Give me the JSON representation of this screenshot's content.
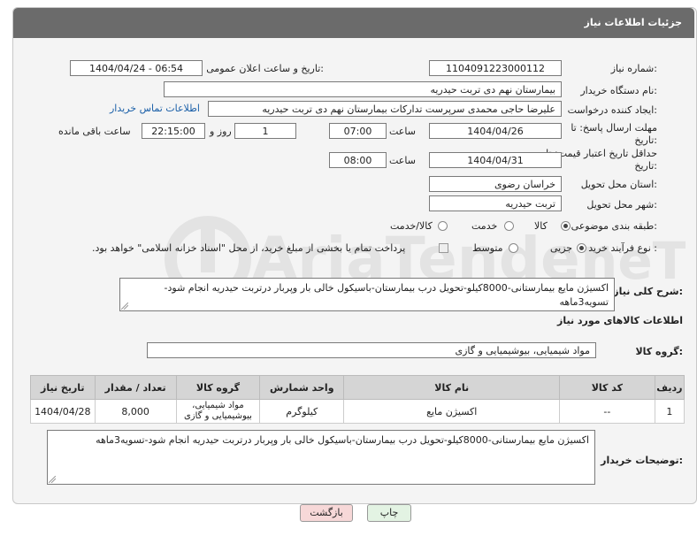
{
  "header": {
    "title": "جزئیات اطلاعات نیاز"
  },
  "fields": {
    "need_number_label": "شماره نیاز:",
    "need_number": "1104091223000112",
    "announce_label": "تاریخ و ساعت اعلان عمومی:",
    "announce_value": "1404/04/24 - 06:54",
    "buyer_org_label": "نام دستگاه خریدار:",
    "buyer_org": "بیمارستان نهم دی تربت حیدریه",
    "requester_label": "ایجاد کننده درخواست:",
    "requester": "علیرضا حاجی محمدی سرپرست تدارکات بیمارستان نهم دی تربت حیدریه",
    "buyer_contact_link": "اطلاعات تماس خریدار",
    "reply_deadline_label": "مهلت ارسال پاسخ: تا تاریخ:",
    "reply_date": "1404/04/26",
    "time_label": "ساعت",
    "reply_time": "07:00",
    "days_value": "1",
    "days_label": "روز و",
    "remaining_time": "22:15:00",
    "remaining_label": "ساعت باقی مانده",
    "price_validity_label": "حداقل تاریخ اعتبار قیمت: تا تاریخ:",
    "validity_date": "1404/04/31",
    "validity_time": "08:00",
    "province_label": "استان محل تحویل:",
    "province": "خراسان رضوی",
    "city_label": "شهر محل تحویل:",
    "city": "تربت حیدریه",
    "category_label": "طبقه بندی موضوعی:",
    "category_options": [
      "کالا",
      "خدمت",
      "کالا/خدمت"
    ],
    "process_label": "نوع فرآیند خرید :",
    "process_options": [
      "جزیی",
      "متوسط"
    ],
    "payment_note": "پرداخت تمام یا بخشی از مبلغ خرید، از محل \"اسناد خزانه اسلامی\" خواهد بود."
  },
  "description": {
    "label": "شرح کلی نیاز:",
    "text": "اکسیژن مایع بیمارستانی-8000کیلو-تحویل درب بیمارستان-باسیکول خالی بار وپربار درتربت حیدریه انجام شود-تسویه3ماهه"
  },
  "goods": {
    "section_title": "اطلاعات کالاهای مورد نیاز",
    "group_label": "گروه کالا:",
    "group_value": "مواد شیمیایی، بیوشیمیایی و  گازی",
    "columns": [
      "ردیف",
      "کد کالا",
      "نام کالا",
      "واحد شمارش",
      "گروه کالا",
      "تعداد / مقدار",
      "تاریخ نیاز"
    ],
    "rows": [
      [
        "1",
        "--",
        "اکسیژن مایع",
        "کیلوگرم",
        "مواد شیمیایی، بیوشیمیایی و گازی",
        "8,000",
        "1404/04/28"
      ]
    ]
  },
  "buyer_notes": {
    "label": "توضیحات خریدار:",
    "text": "اکسیژن مایع بیمارستانی-8000کیلو-تحویل درب بیمارستان-باسیکول خالی بار وپربار درتربت حیدریه انجام شود-تسویه3ماهه"
  },
  "buttons": {
    "print": "چاپ",
    "back": "بازگشت"
  },
  "colors": {
    "header": "#6b6b6b",
    "back_button": "#f7d8d8",
    "print_button": "#e3f3e3"
  }
}
